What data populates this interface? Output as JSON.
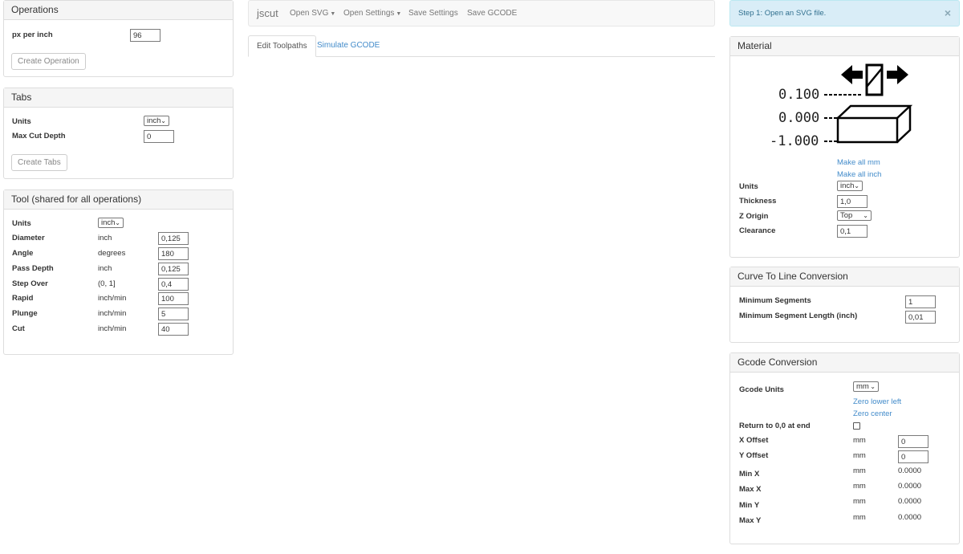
{
  "operations": {
    "title": "Operations",
    "px_per_inch_label": "px per inch",
    "px_per_inch_value": "96",
    "create_button": "Create Operation"
  },
  "tabs_panel": {
    "title": "Tabs",
    "units_label": "Units",
    "units_value": "inch",
    "max_cut_depth_label": "Max Cut Depth",
    "max_cut_depth_value": "0",
    "create_button": "Create Tabs"
  },
  "tool": {
    "title": "Tool (shared for all operations)",
    "units_label": "Units",
    "units_value": "inch",
    "rows": [
      {
        "label": "Diameter",
        "unit": "inch",
        "value": "0,125"
      },
      {
        "label": "Angle",
        "unit": "degrees",
        "value": "180"
      },
      {
        "label": "Pass Depth",
        "unit": "inch",
        "value": "0,125"
      },
      {
        "label": "Step Over",
        "unit": "(0, 1]",
        "value": "0,4"
      },
      {
        "label": "Rapid",
        "unit": "inch/min",
        "value": "100"
      },
      {
        "label": "Plunge",
        "unit": "inch/min",
        "value": "5"
      },
      {
        "label": "Cut",
        "unit": "inch/min",
        "value": "40"
      }
    ]
  },
  "navbar": {
    "brand": "jscut",
    "open_svg": "Open SVG",
    "open_settings": "Open Settings",
    "save_settings": "Save Settings",
    "save_gcode": "Save GCODE"
  },
  "main_tabs": {
    "edit": "Edit Toolpaths",
    "simulate": "Simulate GCODE"
  },
  "alert": {
    "text": "Step 1: Open an SVG file.",
    "close": "×"
  },
  "material": {
    "title": "Material",
    "diagram": {
      "top": "0.100",
      "mid": "0.000",
      "bottom": "-1.000"
    },
    "make_all_mm": "Make all mm",
    "make_all_inch": "Make all inch",
    "units_label": "Units",
    "units_value": "inch",
    "thickness_label": "Thickness",
    "thickness_value": "1,0",
    "z_origin_label": "Z Origin",
    "z_origin_value": "Top",
    "clearance_label": "Clearance",
    "clearance_value": "0,1"
  },
  "curve": {
    "title": "Curve To Line Conversion",
    "min_segments_label": "Minimum Segments",
    "min_segments_value": "1",
    "min_seg_len_label": "Minimum Segment Length (inch)",
    "min_seg_len_value": "0,01"
  },
  "gcode": {
    "title": "Gcode Conversion",
    "units_label": "Gcode Units",
    "units_value": "mm",
    "zero_lower_left": "Zero lower left",
    "zero_center": "Zero center",
    "return_label": "Return to 0,0 at end",
    "x_offset_label": "X Offset",
    "x_offset_unit": "mm",
    "x_offset_value": "0",
    "y_offset_label": "Y Offset",
    "y_offset_unit": "mm",
    "y_offset_value": "0",
    "readouts": [
      {
        "label": "Min X",
        "unit": "mm",
        "value": "0.0000"
      },
      {
        "label": "Max X",
        "unit": "mm",
        "value": "0.0000"
      },
      {
        "label": "Min Y",
        "unit": "mm",
        "value": "0.0000"
      },
      {
        "label": "Max Y",
        "unit": "mm",
        "value": "0.0000"
      }
    ]
  }
}
